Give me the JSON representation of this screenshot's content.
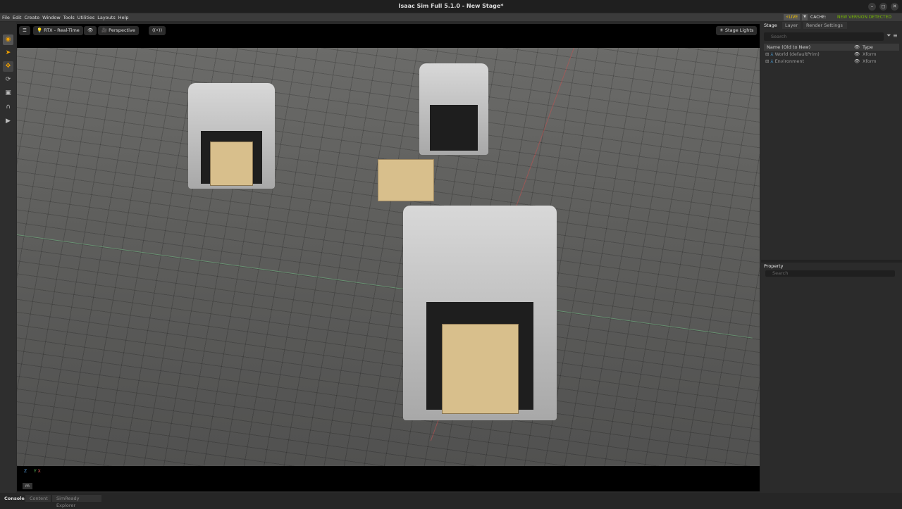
{
  "window": {
    "title": "Isaac Sim Full 5.1.0 - New Stage*",
    "controls": [
      "–",
      "◻",
      "✕"
    ]
  },
  "menu": [
    "File",
    "Edit",
    "Create",
    "Window",
    "Tools",
    "Utilities",
    "Layouts",
    "Help"
  ],
  "status": {
    "live": "LIVE",
    "cache": "CACHE:",
    "new_version": "NEW VERSION DETECTED",
    "accent": "#76b900"
  },
  "viewport": {
    "renderer": "RTX - Real-Time",
    "camera": "Perspective",
    "stage_lights": "Stage Lights",
    "units": "m",
    "axes": {
      "z": "Z",
      "y": "Y",
      "x": "X"
    }
  },
  "stage": {
    "tabs": [
      "Stage",
      "Layer",
      "Render Settings"
    ],
    "search_placeholder": "Search",
    "col_name": "Name (Old to New)",
    "col_type": "Type",
    "items": [
      {
        "name": "World (defaultPrim)",
        "type": "Xform"
      },
      {
        "name": "Environment",
        "type": "Xform"
      }
    ]
  },
  "property": {
    "tab": "Property",
    "search_placeholder": "Search"
  },
  "bottom_tabs": [
    "Console",
    "Content",
    "SimReady Explorer"
  ]
}
